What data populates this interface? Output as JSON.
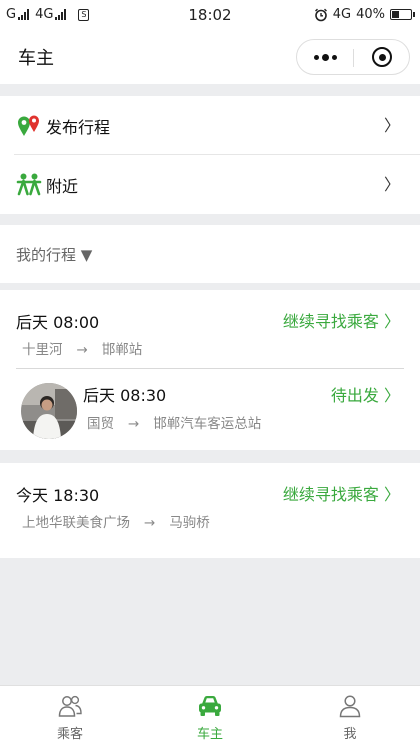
{
  "status_bar": {
    "carrier_1": "G",
    "carrier_2": "4G",
    "time": "18:02",
    "network": "4G",
    "battery": "40%"
  },
  "nav": {
    "title": "车主"
  },
  "menu": {
    "publish_label": "发布行程",
    "nearby_label": "附近",
    "arrow": "〉"
  },
  "trips_header": {
    "label": "我的行程 ▼"
  },
  "trips": [
    {
      "time": "后天 08:00",
      "from": "十里河",
      "to": "邯郸站",
      "arrow": "→",
      "action": "继续寻找乘客 〉"
    },
    {
      "time": "后天 08:30",
      "from": "国贸",
      "to": "邯郸汽车客运总站",
      "arrow": "→",
      "action": "待出发 〉"
    },
    {
      "time": "今天 18:30",
      "from": "上地华联美食广场",
      "to": "马驹桥",
      "arrow": "→",
      "action": "继续寻找乘客 〉"
    }
  ],
  "tabs": [
    {
      "label": "乘客",
      "icon": "people-icon",
      "active": false
    },
    {
      "label": "车主",
      "icon": "car-icon",
      "active": true
    },
    {
      "label": "我",
      "icon": "person-icon",
      "active": false
    }
  ],
  "colors": {
    "accent_green": "#3aa93e",
    "background": "#ecedef",
    "pin_red": "#e0332e"
  }
}
